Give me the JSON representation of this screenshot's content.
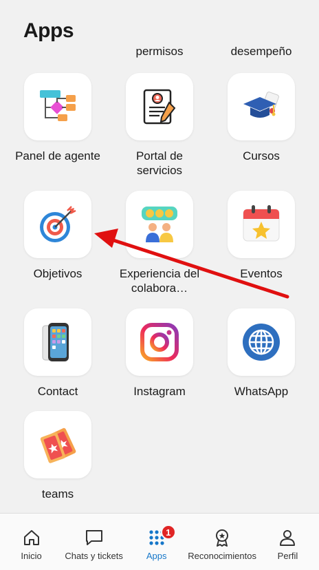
{
  "header": {
    "title": "Apps"
  },
  "cut_off_labels": [
    "permisos",
    "desempeño"
  ],
  "apps": [
    {
      "label": "Panel de agente",
      "icon": "flowchart-icon"
    },
    {
      "label": "Portal de servicios",
      "icon": "document-profile-icon"
    },
    {
      "label": "Cursos",
      "icon": "graduation-cap-icon"
    },
    {
      "label": "Objetivos",
      "icon": "target-icon"
    },
    {
      "label": "Experiencia del  colabora…",
      "icon": "feedback-faces-icon"
    },
    {
      "label": "Eventos",
      "icon": "calendar-star-icon"
    },
    {
      "label": "Contact",
      "icon": "phone-icon"
    },
    {
      "label": "Instagram",
      "icon": "instagram-icon"
    },
    {
      "label": "WhatsApp",
      "icon": "globe-icon"
    },
    {
      "label": "teams",
      "icon": "tickets-icon"
    }
  ],
  "tabbar": {
    "items": [
      {
        "label": "Inicio",
        "icon": "home-icon"
      },
      {
        "label": "Chats y tickets",
        "icon": "chat-icon"
      },
      {
        "label": "Apps",
        "icon": "apps-grid-icon",
        "active": true,
        "badge": "1"
      },
      {
        "label": "Reconocimientos",
        "icon": "medal-icon"
      },
      {
        "label": "Perfil",
        "icon": "user-icon"
      }
    ]
  },
  "colors": {
    "accent": "#1677c9",
    "badge": "#e02525",
    "annotation_arrow": "#e01010"
  }
}
